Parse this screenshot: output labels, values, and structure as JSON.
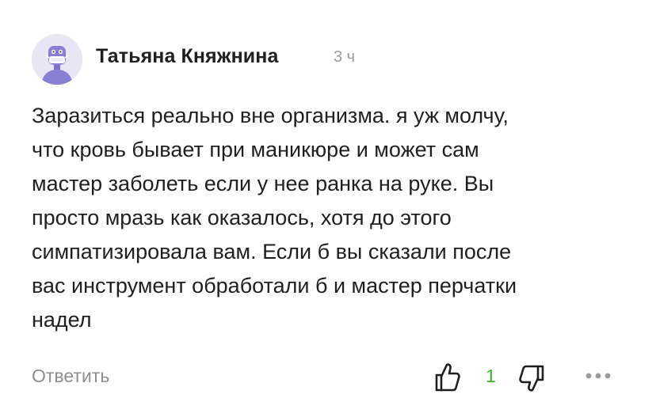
{
  "comment": {
    "author": "Татьяна Княжнина",
    "time": "3 ч",
    "avatar_icon": "masked-robot-avatar-icon",
    "text_lines": [
      "Заразиться реально вне организма. я уж молчу,",
      "что кровь бывает при маникюре и может сам",
      "мастер заболеть если у нее ранка на руке. Вы",
      "просто мразь как оказалось, хотя до этого",
      "симпатизировала вам. Если б вы сказали после",
      "вас инструмент обработали б и мастер перчатки",
      "надел"
    ]
  },
  "actions": {
    "reply_label": "Ответить",
    "like_icon": "thumbs-up-icon",
    "like_count": "1",
    "dislike_icon": "thumbs-down-icon",
    "more_icon": "more-dots-icon"
  },
  "colors": {
    "text": "#1f1f1f",
    "muted": "#8e8e8e",
    "like_count": "#3fae2a",
    "avatar_bg": "#e8e6f3",
    "avatar_accent": "#8b7fd4"
  }
}
